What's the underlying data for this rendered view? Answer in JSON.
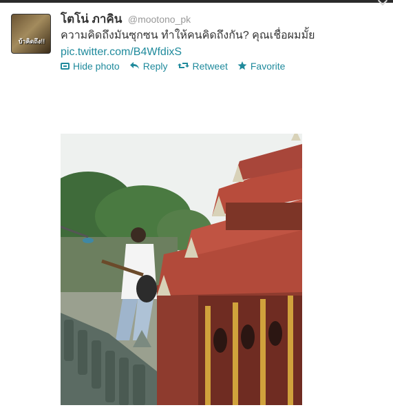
{
  "tweet": {
    "fullname": "โตโน่ ภาคิน",
    "username": "@mootono_pk",
    "text": "ความคิดถึงมันซุกซน ทำให้คนคิดถึงกัน? คุณเชื่อผมมั้ย",
    "link": "pic.twitter.com/B4WfdixS",
    "avatar_text": "บ้าคิดถึง!!"
  },
  "actions": {
    "hide_photo": "Hide photo",
    "reply": "Reply",
    "retweet": "Retweet",
    "favorite": "Favorite"
  },
  "icons": {
    "hide_photo": "photo-icon",
    "reply": "reply-arrow-icon",
    "retweet": "retweet-icon",
    "favorite": "star-icon"
  },
  "colors": {
    "link": "#1f8a9c",
    "name": "#333333",
    "username": "#999999"
  }
}
